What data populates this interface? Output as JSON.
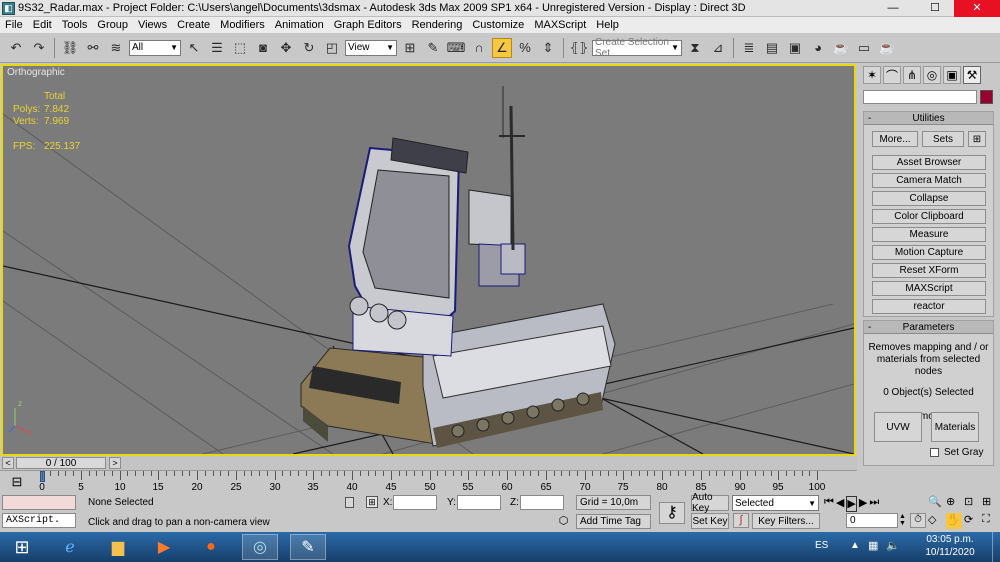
{
  "window": {
    "title": "9S32_Radar.max      - Project Folder: C:\\Users\\angel\\Documents\\3dsmax      - Autodesk 3ds Max  2009 SP1  x64   - Unregistered Version      - Display : Direct 3D",
    "minimize": "—",
    "maximize": "☐",
    "close": "✕"
  },
  "menu": [
    "File",
    "Edit",
    "Tools",
    "Group",
    "Views",
    "Create",
    "Modifiers",
    "Animation",
    "Graph Editors",
    "Rendering",
    "Customize",
    "MAXScript",
    "Help"
  ],
  "toolbar": {
    "selection_filter": "All",
    "ref_coord": "View",
    "named_selection_placeholder": "Create Selection Set"
  },
  "viewport": {
    "label": "Orthographic",
    "stats": {
      "total_label": "Total",
      "polys_label": "Polys:",
      "polys_value": "7.842",
      "verts_label": "Verts:",
      "verts_value": "7.969",
      "fps_label": "FPS:",
      "fps_value": "225.137"
    },
    "axis": {
      "z": "z",
      "x": "x"
    }
  },
  "command_panel": {
    "utilities": {
      "title": "Utilities",
      "more": "More...",
      "sets": "Sets",
      "buttons": [
        "Asset Browser",
        "Camera Match",
        "Collapse",
        "Color Clipboard",
        "Measure",
        "Motion Capture",
        "Reset XForm",
        "MAXScript",
        "reactor"
      ]
    },
    "parameters": {
      "title": "Parameters",
      "description": "Removes mapping and / or materials from selected nodes",
      "selected": "0 Object(s) Selected",
      "remove_label": "Remove :",
      "uvw": "UVW",
      "materials": "Materials",
      "set_gray": "Set Gray"
    },
    "colors": {
      "object_color": "#980030"
    }
  },
  "timeline": {
    "frame_display": "0 / 100",
    "prev": "<",
    "next": ">",
    "ticks": [
      "0",
      "5",
      "10",
      "15",
      "20",
      "25",
      "30",
      "35",
      "40",
      "45",
      "50",
      "55",
      "60",
      "65",
      "70",
      "75",
      "80",
      "85",
      "90",
      "95",
      "100"
    ]
  },
  "status": {
    "maxscript_listener": "AXScript.",
    "selection": "None Selected",
    "prompt": "Click and drag to pan a non-camera view",
    "x_label": "X:",
    "y_label": "Y:",
    "z_label": "Z:",
    "grid": "Grid = 10,0m",
    "add_time_tag": "Add Time Tag",
    "auto_key": "Auto Key",
    "set_key": "Set Key",
    "key_mode": "Selected",
    "key_filters": "Key Filters...",
    "current_frame": "0"
  },
  "taskbar": {
    "language": "ES",
    "time": "03:05 p.m.",
    "date": "10/11/2020"
  }
}
